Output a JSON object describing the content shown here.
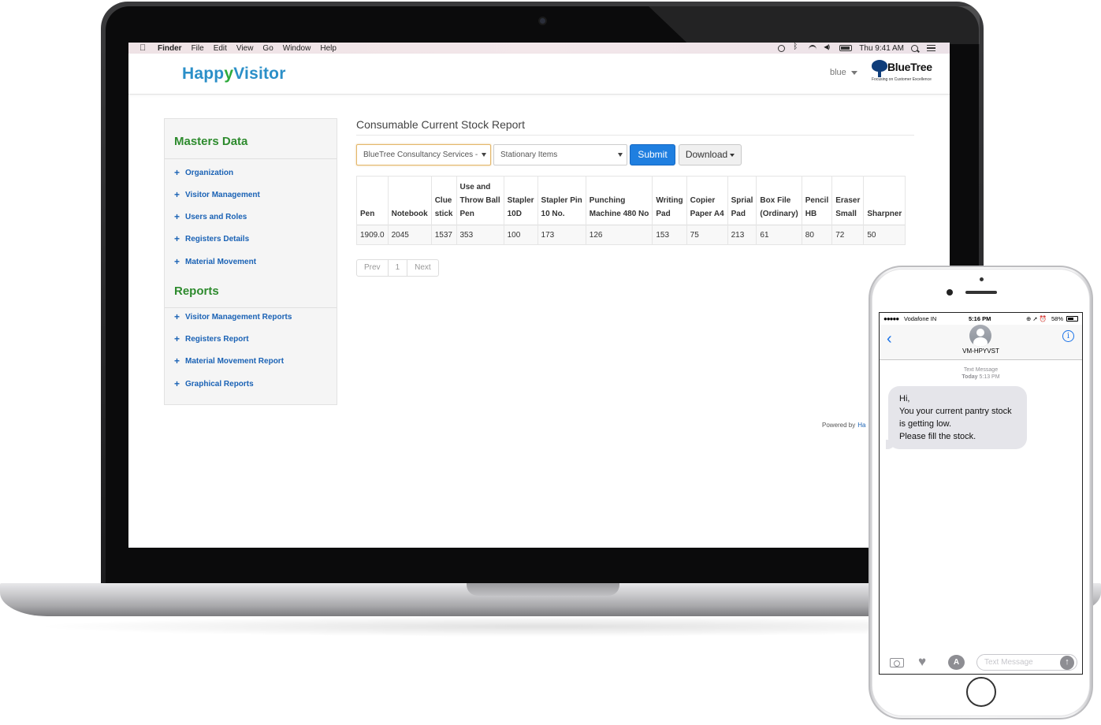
{
  "menubar": {
    "app": "Finder",
    "items": [
      "File",
      "Edit",
      "View",
      "Go",
      "Window",
      "Help"
    ],
    "clock": "Thu 9:41 AM"
  },
  "header": {
    "logo_left": "Happ",
    "logo_mid": "y",
    "logo_right": "Visitor",
    "user": "blue",
    "brand_name": "BlueTree",
    "brand_tagline": "Focusing on Customer Excellence"
  },
  "sidebar": {
    "masters_heading": "Masters Data",
    "masters": [
      "Organization",
      "Visitor Management",
      "Users and Roles",
      "Registers Details",
      "Material Movement"
    ],
    "reports_heading": "Reports",
    "reports": [
      "Visitor Management Reports",
      "Registers Report",
      "Material Movement Report",
      "Graphical Reports"
    ]
  },
  "main": {
    "title": "Consumable Current Stock Report",
    "company_select": "BlueTree Consultancy Services -",
    "category_select": "Stationary Items",
    "submit_label": "Submit",
    "download_label": "Download",
    "columns": [
      [
        "Pen"
      ],
      [
        "Notebook"
      ],
      [
        "Clue",
        "stick"
      ],
      [
        "Use and",
        "Throw Ball",
        "Pen"
      ],
      [
        "Stapler",
        "10D"
      ],
      [
        "Stapler Pin",
        "10 No."
      ],
      [
        "Punching",
        "Machine 480 No"
      ],
      [
        "Writing",
        "Pad"
      ],
      [
        "Copier",
        "Paper A4"
      ],
      [
        "Sprial",
        "Pad"
      ],
      [
        "Box File",
        "(Ordinary)"
      ],
      [
        "Pencil",
        "HB"
      ],
      [
        "Eraser",
        "Small"
      ],
      [
        "Sharpner"
      ]
    ],
    "row": [
      "1909.0",
      "2045",
      "1537",
      "353",
      "100",
      "173",
      "126",
      "153",
      "75",
      "213",
      "61",
      "80",
      "72",
      "50"
    ],
    "pager": {
      "prev": "Prev",
      "page": "1",
      "next": "Next"
    },
    "powered_by": "Powered by",
    "powered_link": "Ha"
  },
  "phone": {
    "carrier": "Vodafone IN",
    "signal": "●●●●●",
    "time": "5:16 PM",
    "battery": "58%",
    "contact": "VM-HPYVST",
    "info_icon": "i",
    "meta_label": "Text Message",
    "meta_day": "Today",
    "meta_time": "5:13 PM",
    "message": "Hi,\nYou your current pantry stock is getting low.\nPlease fill the stock.",
    "input_placeholder": "Text Message"
  }
}
